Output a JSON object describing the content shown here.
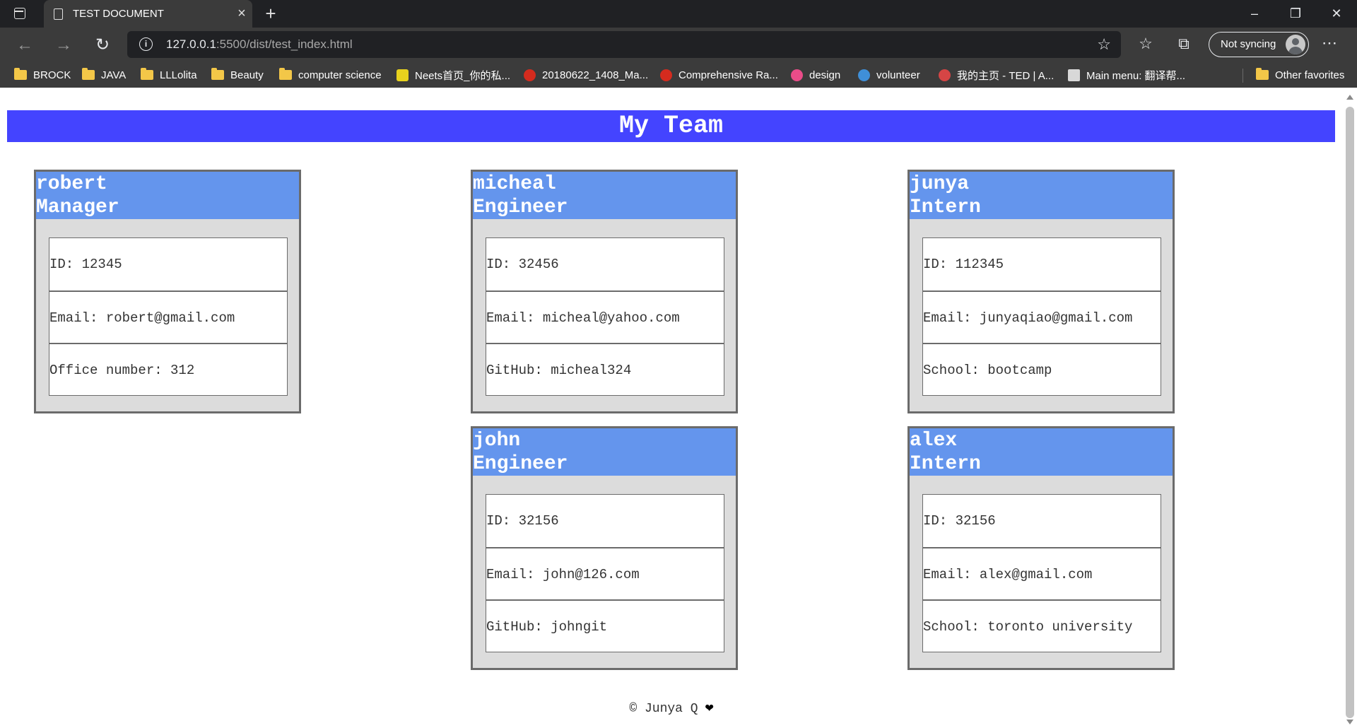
{
  "browser": {
    "tab_title": "TEST DOCUMENT",
    "url_host": "127.0.0.1",
    "url_rest": ":5500/dist/test_index.html",
    "sync_label": "Not syncing",
    "bookmarks": [
      "BROCK",
      "JAVA",
      "LLLolita",
      "Beauty",
      "computer science",
      "Neets首页_你的私...",
      "20180622_1408_Ma...",
      "Comprehensive Ra...",
      "design",
      "volunteer",
      "我的主页 - TED | A...",
      "Main menu: 翻译帮..."
    ],
    "other_favorites": "Other favorites"
  },
  "page": {
    "title": "My Team",
    "footer": "© Junya Q"
  },
  "team": [
    {
      "name": "robert",
      "role": "Manager",
      "id": "ID: 12345",
      "email": "Email: robert@gmail.com",
      "extra": "Office number: 312"
    },
    {
      "name": "micheal",
      "role": "Engineer",
      "id": "ID: 32456",
      "email": "Email: micheal@yahoo.com",
      "extra": "GitHub: micheal324"
    },
    {
      "name": "junya",
      "role": "Intern",
      "id": "ID: 112345",
      "email": "Email: junyaqiao@gmail.com",
      "extra": "School: bootcamp"
    },
    {
      "name": "john",
      "role": "Engineer",
      "id": "ID: 32156",
      "email": "Email: john@126.com",
      "extra": "GitHub: johngit"
    },
    {
      "name": "alex",
      "role": "Intern",
      "id": "ID: 32156",
      "email": "Email: alex@gmail.com",
      "extra": "School: toronto university"
    }
  ],
  "colors": {
    "banner": "#4444ff",
    "card_header": "#6495ed",
    "card_body": "#dcdcdc"
  }
}
